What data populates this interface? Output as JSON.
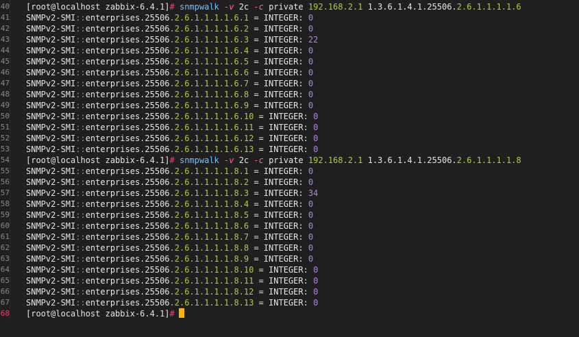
{
  "terminal": {
    "blocks": [
      {
        "prompt": {
          "line_no": "40",
          "prompt_text": "[root@localhost zabbix-6.4.1]",
          "hash": "#",
          "cmd": "snmpwalk",
          "flag_v": "-v",
          "ver": "2c",
          "flag_c": "-c",
          "community": "private",
          "ip": "192.168.2.1",
          "oid_a": "1.3.6.1",
          "oid_b": ".4.1.25506.",
          "oid_c": "2.6.1.1.1.1.6"
        },
        "rows": [
          {
            "line_no": "41",
            "mib": "SNMPv2-SMI",
            "sep": "::",
            "base": "enterprises.25506",
            "tail": ".2.6.1.1.1.1.6.1",
            "eq": " = INTEGER: ",
            "val": "0"
          },
          {
            "line_no": "42",
            "mib": "SNMPv2-SMI",
            "sep": "::",
            "base": "enterprises.25506",
            "tail": ".2.6.1.1.1.1.6.2",
            "eq": " = INTEGER: ",
            "val": "0"
          },
          {
            "line_no": "43",
            "mib": "SNMPv2-SMI",
            "sep": "::",
            "base": "enterprises.25506",
            "tail": ".2.6.1.1.1.1.6.3",
            "eq": " = INTEGER: ",
            "val": "22"
          },
          {
            "line_no": "44",
            "mib": "SNMPv2-SMI",
            "sep": "::",
            "base": "enterprises.25506",
            "tail": ".2.6.1.1.1.1.6.4",
            "eq": " = INTEGER: ",
            "val": "0"
          },
          {
            "line_no": "45",
            "mib": "SNMPv2-SMI",
            "sep": "::",
            "base": "enterprises.25506",
            "tail": ".2.6.1.1.1.1.6.5",
            "eq": " = INTEGER: ",
            "val": "0"
          },
          {
            "line_no": "46",
            "mib": "SNMPv2-SMI",
            "sep": "::",
            "base": "enterprises.25506",
            "tail": ".2.6.1.1.1.1.6.6",
            "eq": " = INTEGER: ",
            "val": "0"
          },
          {
            "line_no": "47",
            "mib": "SNMPv2-SMI",
            "sep": "::",
            "base": "enterprises.25506",
            "tail": ".2.6.1.1.1.1.6.7",
            "eq": " = INTEGER: ",
            "val": "0"
          },
          {
            "line_no": "48",
            "mib": "SNMPv2-SMI",
            "sep": "::",
            "base": "enterprises.25506",
            "tail": ".2.6.1.1.1.1.6.8",
            "eq": " = INTEGER: ",
            "val": "0"
          },
          {
            "line_no": "49",
            "mib": "SNMPv2-SMI",
            "sep": "::",
            "base": "enterprises.25506",
            "tail": ".2.6.1.1.1.1.6.9",
            "eq": " = INTEGER: ",
            "val": "0"
          },
          {
            "line_no": "50",
            "mib": "SNMPv2-SMI",
            "sep": "::",
            "base": "enterprises.25506",
            "tail": ".2.6.1.1.1.1.6.10",
            "eq": " = INTEGER: ",
            "val": "0"
          },
          {
            "line_no": "51",
            "mib": "SNMPv2-SMI",
            "sep": "::",
            "base": "enterprises.25506",
            "tail": ".2.6.1.1.1.1.6.11",
            "eq": " = INTEGER: ",
            "val": "0"
          },
          {
            "line_no": "52",
            "mib": "SNMPv2-SMI",
            "sep": "::",
            "base": "enterprises.25506",
            "tail": ".2.6.1.1.1.1.6.12",
            "eq": " = INTEGER: ",
            "val": "0"
          },
          {
            "line_no": "53",
            "mib": "SNMPv2-SMI",
            "sep": "::",
            "base": "enterprises.25506",
            "tail": ".2.6.1.1.1.1.6.13",
            "eq": " = INTEGER: ",
            "val": "0"
          }
        ]
      },
      {
        "prompt": {
          "line_no": "54",
          "prompt_text": "[root@localhost zabbix-6.4.1]",
          "hash": "#",
          "cmd": "snmpwalk",
          "flag_v": "-v",
          "ver": "2c",
          "flag_c": "-c",
          "community": "private",
          "ip": "192.168.2.1",
          "oid_a": "1.3.6.1",
          "oid_b": ".4.1.25506.",
          "oid_c": "2.6.1.1.1.1.8"
        },
        "rows": [
          {
            "line_no": "55",
            "mib": "SNMPv2-SMI",
            "sep": "::",
            "base": "enterprises.25506",
            "tail": ".2.6.1.1.1.1.8.1",
            "eq": " = INTEGER: ",
            "val": "0"
          },
          {
            "line_no": "56",
            "mib": "SNMPv2-SMI",
            "sep": "::",
            "base": "enterprises.25506",
            "tail": ".2.6.1.1.1.1.8.2",
            "eq": " = INTEGER: ",
            "val": "0"
          },
          {
            "line_no": "57",
            "mib": "SNMPv2-SMI",
            "sep": "::",
            "base": "enterprises.25506",
            "tail": ".2.6.1.1.1.1.8.3",
            "eq": " = INTEGER: ",
            "val": "34"
          },
          {
            "line_no": "58",
            "mib": "SNMPv2-SMI",
            "sep": "::",
            "base": "enterprises.25506",
            "tail": ".2.6.1.1.1.1.8.4",
            "eq": " = INTEGER: ",
            "val": "0"
          },
          {
            "line_no": "59",
            "mib": "SNMPv2-SMI",
            "sep": "::",
            "base": "enterprises.25506",
            "tail": ".2.6.1.1.1.1.8.5",
            "eq": " = INTEGER: ",
            "val": "0"
          },
          {
            "line_no": "60",
            "mib": "SNMPv2-SMI",
            "sep": "::",
            "base": "enterprises.25506",
            "tail": ".2.6.1.1.1.1.8.6",
            "eq": " = INTEGER: ",
            "val": "0"
          },
          {
            "line_no": "61",
            "mib": "SNMPv2-SMI",
            "sep": "::",
            "base": "enterprises.25506",
            "tail": ".2.6.1.1.1.1.8.7",
            "eq": " = INTEGER: ",
            "val": "0"
          },
          {
            "line_no": "62",
            "mib": "SNMPv2-SMI",
            "sep": "::",
            "base": "enterprises.25506",
            "tail": ".2.6.1.1.1.1.8.8",
            "eq": " = INTEGER: ",
            "val": "0"
          },
          {
            "line_no": "63",
            "mib": "SNMPv2-SMI",
            "sep": "::",
            "base": "enterprises.25506",
            "tail": ".2.6.1.1.1.1.8.9",
            "eq": " = INTEGER: ",
            "val": "0"
          },
          {
            "line_no": "64",
            "mib": "SNMPv2-SMI",
            "sep": "::",
            "base": "enterprises.25506",
            "tail": ".2.6.1.1.1.1.8.10",
            "eq": " = INTEGER: ",
            "val": "0"
          },
          {
            "line_no": "65",
            "mib": "SNMPv2-SMI",
            "sep": "::",
            "base": "enterprises.25506",
            "tail": ".2.6.1.1.1.1.8.11",
            "eq": " = INTEGER: ",
            "val": "0"
          },
          {
            "line_no": "66",
            "mib": "SNMPv2-SMI",
            "sep": "::",
            "base": "enterprises.25506",
            "tail": ".2.6.1.1.1.1.8.12",
            "eq": " = INTEGER: ",
            "val": "0"
          },
          {
            "line_no": "67",
            "mib": "SNMPv2-SMI",
            "sep": "::",
            "base": "enterprises.25506",
            "tail": ".2.6.1.1.1.1.8.13",
            "eq": " = INTEGER: ",
            "val": "0"
          }
        ]
      }
    ],
    "final_prompt": {
      "line_no": "68",
      "prompt_text": "[root@localhost zabbix-6.4.1]",
      "hash": "#"
    }
  },
  "colors": {
    "background": "#1f1f1f",
    "text": "#e6e6e6",
    "oid_tail": "#a6d23a",
    "value": "#b183f2",
    "command": "#6ec2ff",
    "flag": "#ff6a9a",
    "hash": "#ff3b6b",
    "cursor": "#ffb400",
    "line_number": "#8a8a8a",
    "current_line_number": "#ff3b6b"
  }
}
